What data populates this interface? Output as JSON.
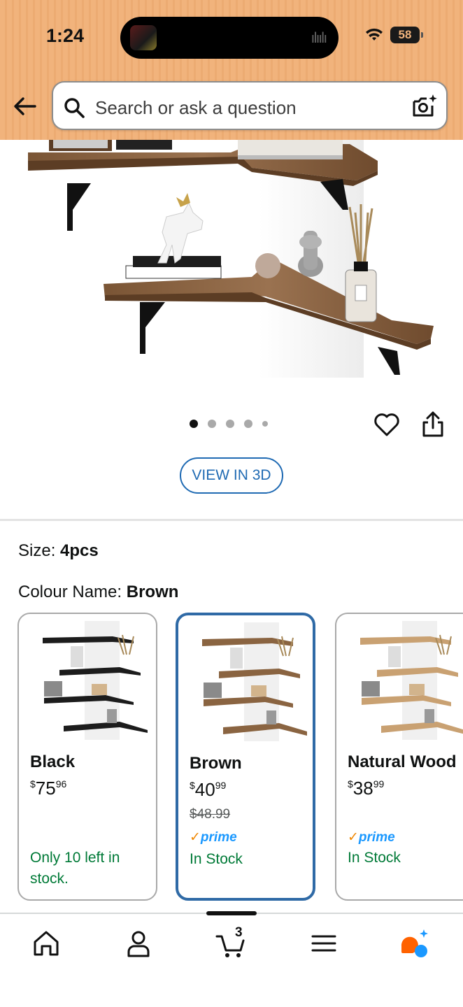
{
  "status_bar": {
    "time": "1:24",
    "battery": "58"
  },
  "search": {
    "placeholder": "Search or ask a question"
  },
  "gallery": {
    "image_count": 5,
    "active_index": 0
  },
  "view_3d_label": "VIEW IN 3D",
  "options": {
    "size_label": "Size:",
    "size_value": "4pcs",
    "colour_label": "Colour Name:",
    "colour_value": "Brown"
  },
  "colour_cards": [
    {
      "name": "Black",
      "price_dollars": "75",
      "price_cents": "96",
      "currency": "$",
      "stock_line1": "Only 10 left in",
      "stock_line2": "stock.",
      "selected": false
    },
    {
      "name": "Brown",
      "price_dollars": "40",
      "price_cents": "99",
      "currency": "$",
      "was_price": "$48.99",
      "prime": "prime",
      "stock_line1": "In Stock",
      "selected": true
    },
    {
      "name": "Natural Wood",
      "price_dollars": "38",
      "price_cents": "99",
      "currency": "$",
      "prime": "prime",
      "stock_line1": "In Stock",
      "selected": false
    }
  ],
  "cart": {
    "count": "3"
  },
  "nav_items": [
    "home-icon",
    "account-icon",
    "cart-icon",
    "menu-icon",
    "rufus-assistant-icon"
  ],
  "colors": {
    "header_bg": "#f1b37c",
    "link_blue": "#1f6ab3",
    "stock_green": "#007a37",
    "prime_blue": "#1a98ff",
    "prime_orange": "#f08804"
  }
}
